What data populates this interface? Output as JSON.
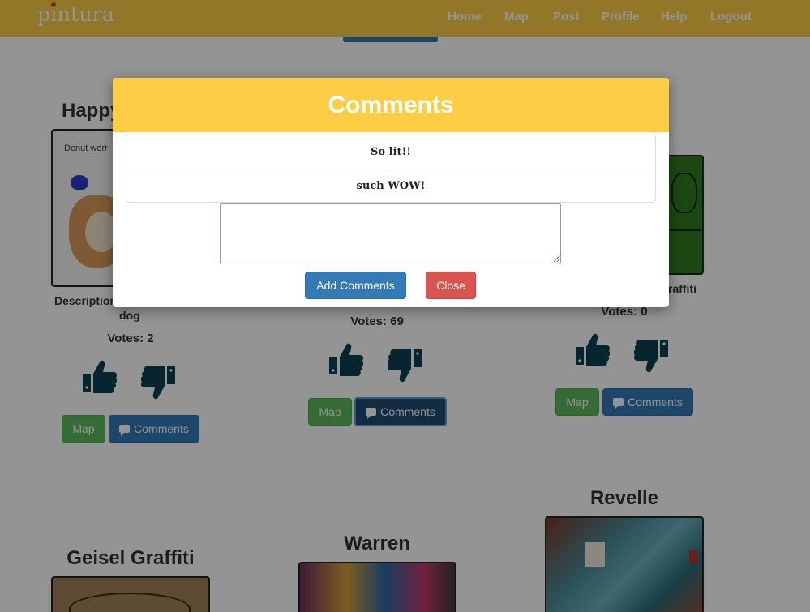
{
  "nav": {
    "brand": "pintura",
    "items": [
      "Home",
      "Map",
      "Post",
      "Profile",
      "Help",
      "Logout"
    ]
  },
  "cards": [
    {
      "title": "Happy",
      "thumb_caption": "Donut worr",
      "desc_label": "Description",
      "desc_wrap": "dog",
      "votes": "Votes: 2",
      "map_label": "Map",
      "comments_label": "Comments"
    },
    {
      "votes": "Votes: 69",
      "map_label": "Map",
      "comments_label": "Comments"
    },
    {
      "desc_tail": "raffiti",
      "votes": "Votes: 0",
      "map_label": "Map",
      "comments_label": "Comments"
    }
  ],
  "lower_cards": [
    {
      "title": "Geisel Graffiti"
    },
    {
      "title": "Warren"
    },
    {
      "title": "Revelle"
    }
  ],
  "modal": {
    "title": "Comments",
    "comments": [
      "So lit!!",
      "such WOW!"
    ],
    "input_value": "",
    "add_label": "Add Comments",
    "close_label": "Close"
  },
  "colors": {
    "navbar": "#fccd45",
    "primary": "#337ab7",
    "success": "#5cb85c",
    "danger": "#d9534f",
    "icon": "#0d4050"
  }
}
